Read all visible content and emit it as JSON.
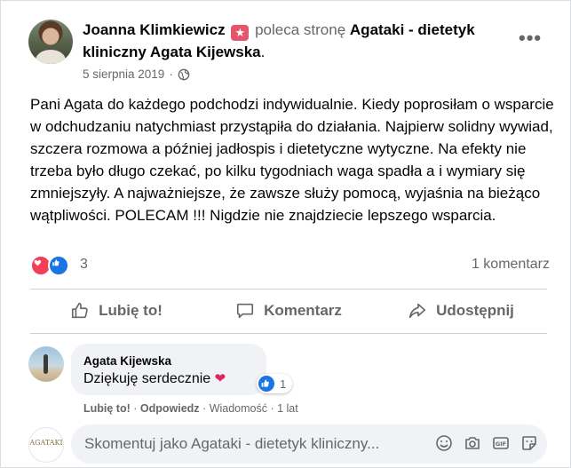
{
  "post": {
    "author": "Joanna Klimkiewicz",
    "recommends": "poleca stronę",
    "page_name": "Agataki - dietetyk kliniczny Agata Kijewska",
    "date": "5 sierpnia 2019",
    "privacy_icon": "globe-icon",
    "more_label": "•••",
    "body": "Pani Agata do każdego podchodzi indywidualnie. Kiedy poprosiłam o wsparcie w odchudzaniu natychmiast przystąpiła do działania. Najpierw solidny wywiad, szczera rozmowa a później jadłospis i dietetyczne wytyczne. Na efekty nie trzeba było długo czekać, po kilku tygodniach waga spadła a i wymiary się zmniejszyły. A najważniejsze, że zawsze służy pomocą, wyjaśnia na bieżąco wątpliwości. POLECAM !!! Nigdzie nie znajdziecie lepszego wsparcia."
  },
  "reactions": {
    "count": "3",
    "comments_count": "1 komentarz"
  },
  "actions": {
    "like": "Lubię to!",
    "comment": "Komentarz",
    "share": "Udostępnij"
  },
  "comment": {
    "author": "Agata Kijewska",
    "text": "Dziękuję serdecznie",
    "reaction_count": "1",
    "like": "Lubię to!",
    "reply": "Odpowiedz",
    "message": "Wiadomość",
    "age": "1 lat"
  },
  "composer": {
    "placeholder": "Skomentuj jako Agataki - dietetyk kliniczny...",
    "avatar_text": "AGATAKI"
  },
  "colors": {
    "like_blue": "#1b74e4",
    "love_red": "#f33e58",
    "muted": "#65676b"
  }
}
